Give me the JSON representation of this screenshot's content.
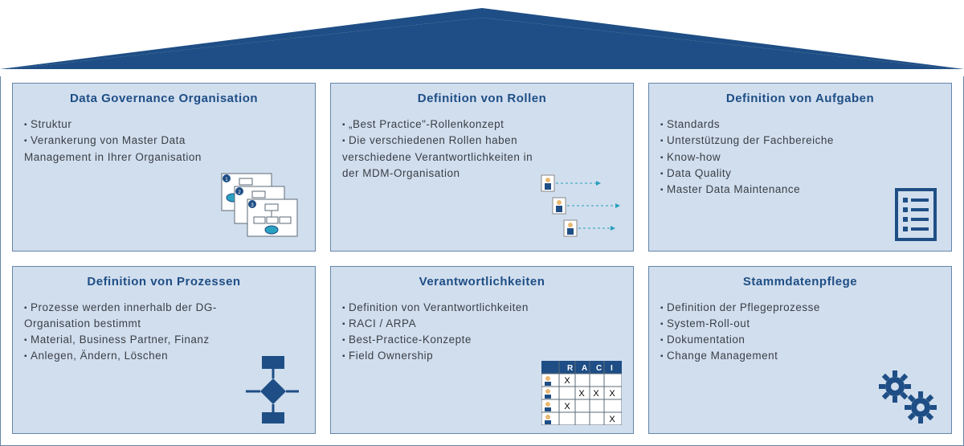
{
  "colors": {
    "primary": "#1e4e85",
    "panel": "#d1deee",
    "border": "#6486a9"
  },
  "cards": [
    {
      "title": "Data Governance Organisation",
      "items": [
        "Struktur",
        "Verankerung von Master Data Management in Ihrer Organisation"
      ],
      "icon": "org-charts-icon"
    },
    {
      "title": "Definition von Rollen",
      "items": [
        "„Best Practice\"-Rollenkonzept",
        "Die verschiedenen Rollen haben verschiedene Verantwortlichkeiten in der MDM-Organisation"
      ],
      "icon": "people-roles-icon"
    },
    {
      "title": "Definition von Aufgaben",
      "items": [
        "Standards",
        "Unterstützung der Fachbereiche",
        "Know-how",
        "Data Quality",
        "Master Data Maintenance"
      ],
      "icon": "checklist-icon"
    },
    {
      "title": "Definition von Prozessen",
      "items": [
        "Prozesse werden innerhalb der DG-Organisation bestimmt",
        "Material, Business Partner, Finanz",
        "Anlegen, Ändern, Löschen"
      ],
      "icon": "flowchart-icon"
    },
    {
      "title": "Verantwortlichkeiten",
      "items": [
        "Definition von Verantwortlichkeiten",
        "RACI / ARPA",
        "Best-Practice-Konzepte",
        "Field Ownership"
      ],
      "icon": "raci-matrix-icon"
    },
    {
      "title": "Stammdatenpflege",
      "items": [
        "Definition der Pflegeprozesse",
        "System-Roll-out",
        "Dokumentation",
        "Change Management"
      ],
      "icon": "gears-icon"
    }
  ]
}
